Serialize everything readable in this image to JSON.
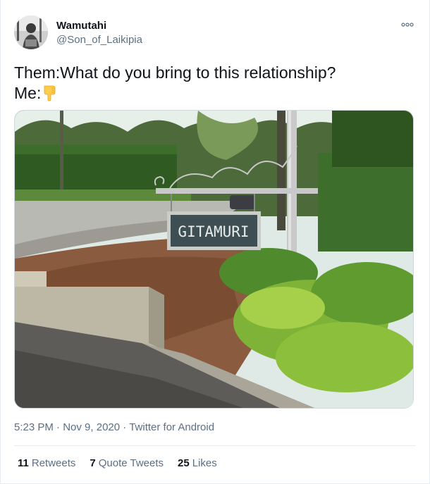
{
  "user": {
    "display_name": "Wamutahi",
    "handle": "@Son_of_Laikipia"
  },
  "tweet": {
    "line1": "Them:What do you bring to this relationship?",
    "line2": "Me:",
    "emoji": "backhand-index-pointing-down",
    "image_sign_text": "GITAMURI"
  },
  "meta": {
    "time": "5:23 PM",
    "sep1": "·",
    "date": "Nov 9, 2020",
    "sep2": "·",
    "source": "Twitter for Android"
  },
  "stats": {
    "retweets_count": "11",
    "retweets_label": "Retweets",
    "quotes_count": "7",
    "quotes_label": "Quote Tweets",
    "likes_count": "25",
    "likes_label": "Likes"
  },
  "colors": {
    "text": "#0f1419",
    "secondary": "#5b7083",
    "divider": "#e6ecf0"
  }
}
